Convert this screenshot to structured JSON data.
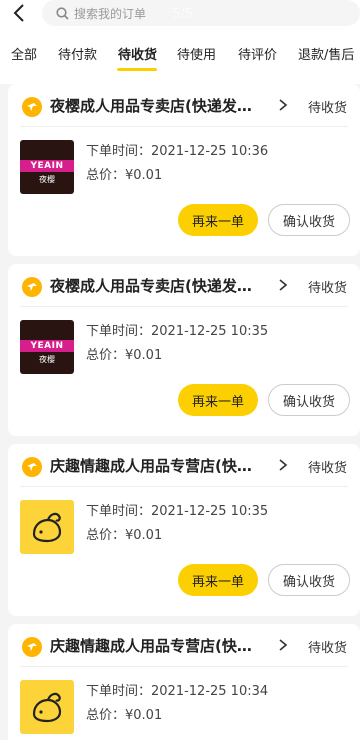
{
  "header": {
    "search_placeholder": "搜索我的订单",
    "page_indicator": "5/5"
  },
  "tabs": [
    {
      "label": "全部"
    },
    {
      "label": "待付款"
    },
    {
      "label": "待收货",
      "active": true
    },
    {
      "label": "待使用"
    },
    {
      "label": "待评价"
    },
    {
      "label": "退款/售后"
    }
  ],
  "orders": [
    {
      "shop_name": "夜樱成人用品专卖店(快递发…",
      "status": "待收货",
      "thumb": "yeain",
      "thumb_text": "YEAIN",
      "thumb_sub": "夜樱",
      "order_time": "下单时间：2021-12-25 10:36",
      "total": "总价：¥0.01",
      "again_label": "再来一单",
      "confirm_label": "确认收货"
    },
    {
      "shop_name": "夜樱成人用品专卖店(快递发…",
      "status": "待收货",
      "thumb": "yeain",
      "thumb_text": "YEAIN",
      "thumb_sub": "夜樱",
      "order_time": "下单时间：2021-12-25 10:35",
      "total": "总价：¥0.01",
      "again_label": "再来一单",
      "confirm_label": "确认收货"
    },
    {
      "shop_name": "庆趣情趣成人用品专营店(快…",
      "status": "待收货",
      "thumb": "qingqu",
      "order_time": "下单时间：2021-12-25 10:35",
      "total": "总价：¥0.01",
      "again_label": "再来一单",
      "confirm_label": "确认收货"
    },
    {
      "shop_name": "庆趣情趣成人用品专营店(快…",
      "status": "待收货",
      "thumb": "qingqu",
      "order_time": "下单时间：2021-12-25 10:34",
      "total": "总价：¥0.01"
    }
  ],
  "colors": {
    "accent": "#fcd000",
    "shop_icon": "#ffb400",
    "background": "#f4f4f4"
  }
}
